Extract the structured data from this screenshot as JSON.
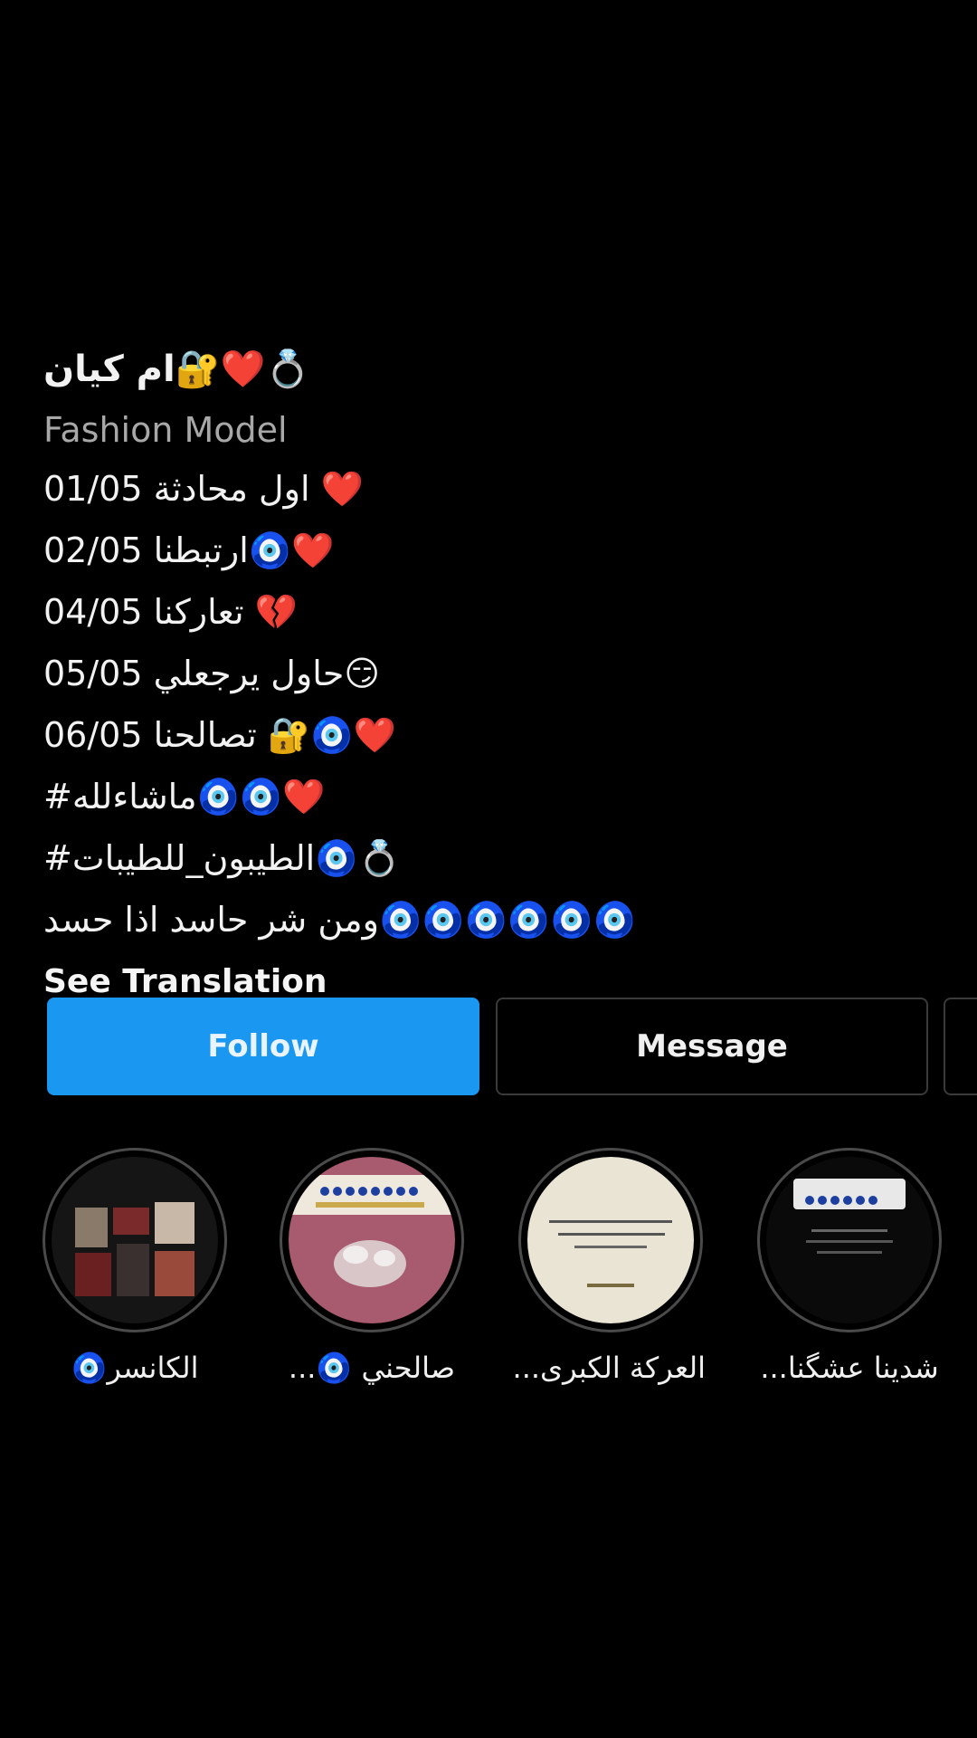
{
  "profile": {
    "name": "💍❤️🔐ام كيان",
    "category": "Fashion Model",
    "bio_lines": [
      "❤️ اول محادثة 01/05",
      "❤️🧿ارتبطنا 02/05",
      "💔 تعاركنا 04/05",
      "😏حاول يرجعلي 05/05",
      "❤️🧿🔐 تصالحنا 06/05",
      "❤️🧿🧿ماشاءلله#",
      "💍🧿الطيبون_للطيبات#",
      "🧿🧿🧿🧿🧿🧿ومن شر حاسد اذا حسد"
    ],
    "see_translation": "See Translation"
  },
  "actions": {
    "follow_label": "Follow",
    "message_label": "Message"
  },
  "highlights": [
    {
      "label": "شدينا عشگنا..."
    },
    {
      "label": "العركة الكبرى..."
    },
    {
      "label": "صالحني 🧿..."
    },
    {
      "label": "الكانسر🧿"
    }
  ],
  "colors": {
    "background": "#000000",
    "follow_button": "#1a97f0",
    "secondary_text": "#a8a8a8"
  }
}
